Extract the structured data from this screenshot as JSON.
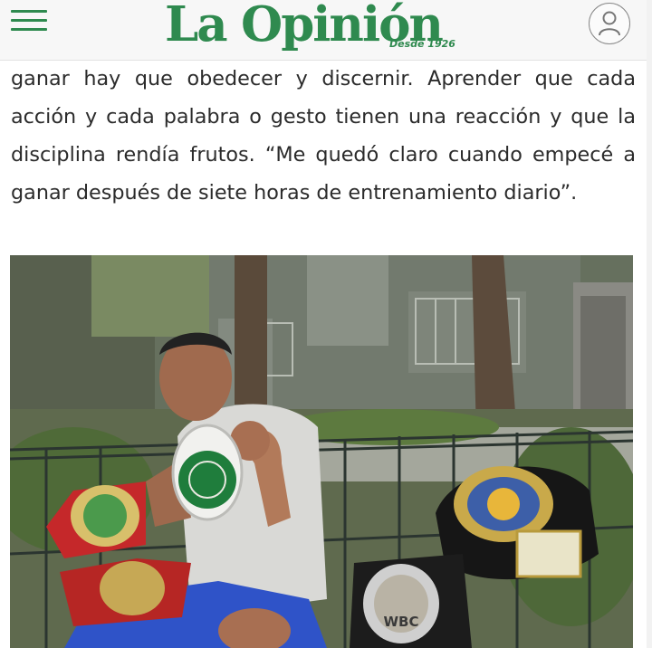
{
  "header": {
    "logo": "La Opinión",
    "logo_tagline": "Desde 1926",
    "menu_icon": "hamburger-menu-icon",
    "account_icon": "user-account-icon"
  },
  "article": {
    "text": "ganar hay que obedecer y discernir. Aprender que cada acción y cada palabra o gesto tienen una reacción y que la disciplina rendía frutos. “Me quedó claro cuando empecé a ganar después de siete horas de entrenamiento diario”."
  },
  "photo": {
    "belt_label": "WBC"
  },
  "colors": {
    "brand": "#2f8a4f",
    "text": "#2b2b2b"
  }
}
